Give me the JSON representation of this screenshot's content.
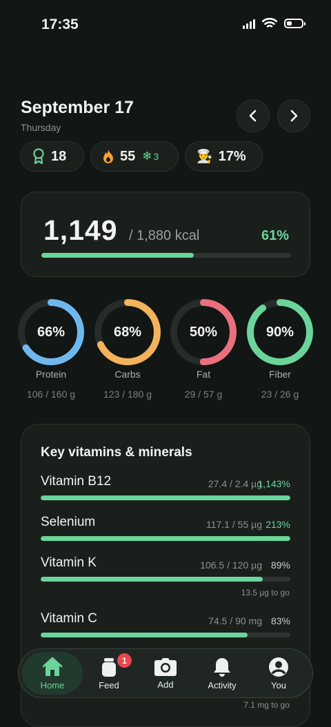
{
  "status": {
    "time": "17:35"
  },
  "header": {
    "date": "September 17",
    "weekday": "Thursday"
  },
  "chips": {
    "award_count": "18",
    "streak_count": "55",
    "freeze_count": "3",
    "chef_percent": "17%"
  },
  "calories": {
    "current": "1,149",
    "goal": "/ 1,880 kcal",
    "percent_label": "61%",
    "progress": 0.61
  },
  "macros": [
    {
      "label": "Protein",
      "percent_label": "66%",
      "value": "106 / 160 g",
      "progress": 0.66,
      "color": "#6fb8ee"
    },
    {
      "label": "Carbs",
      "percent_label": "68%",
      "value": "123 / 180 g",
      "progress": 0.68,
      "color": "#f2b35c"
    },
    {
      "label": "Fat",
      "percent_label": "50%",
      "value": "29 / 57 g",
      "progress": 0.5,
      "color": "#ea707e"
    },
    {
      "label": "Fiber",
      "percent_label": "90%",
      "value": "23 / 26 g",
      "progress": 0.9,
      "color": "#6bd49b"
    }
  ],
  "vitamins": {
    "title": "Key vitamins & minerals",
    "items": [
      {
        "name": "Vitamin B12",
        "amount": "27.4 / 2.4 µg",
        "percent_label": "1,143%",
        "progress": 1.0,
        "pct_color": "#6bd49b",
        "to_go": ""
      },
      {
        "name": "Selenium",
        "amount": "117.1 / 55 µg",
        "percent_label": "213%",
        "progress": 1.0,
        "pct_color": "#6bd49b",
        "to_go": ""
      },
      {
        "name": "Vitamin K",
        "amount": "106.5 / 120 µg",
        "percent_label": "89%",
        "progress": 0.89,
        "pct_color": "#c9cfcc",
        "to_go": "13.5 µg to go"
      },
      {
        "name": "Vitamin C",
        "amount": "74.5 / 90 mg",
        "percent_label": "83%",
        "progress": 0.83,
        "pct_color": "#c9cfcc",
        "to_go": ""
      }
    ],
    "hidden_to_go": "7.1 mg to go"
  },
  "tabs": {
    "home": "Home",
    "feed": "Feed",
    "feed_badge": "1",
    "add": "Add",
    "activity": "Activity",
    "you": "You"
  },
  "colors": {
    "accent": "#6bd49b",
    "background": "#121614",
    "card": "#1a1f1c"
  },
  "icons": {
    "award": "award-ribbon-icon",
    "streak": "flame-icon",
    "freeze": "snowflake-icon",
    "chef": "chef-emoji-icon",
    "prev": "chevron-left-icon",
    "next": "chevron-right-icon",
    "home": "home-icon",
    "feed": "jar-icon",
    "add": "camera-icon",
    "activity": "bell-icon",
    "you": "user-icon"
  }
}
